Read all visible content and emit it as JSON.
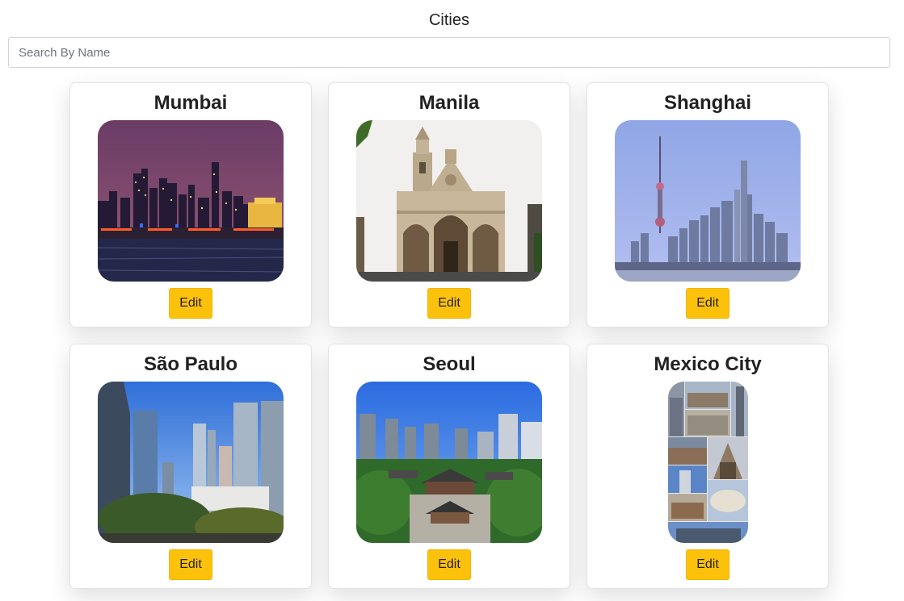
{
  "header": {
    "title": "Cities"
  },
  "search": {
    "placeholder": "Search By Name",
    "value": ""
  },
  "cities": [
    {
      "name": "Mumbai",
      "edit_label": "Edit"
    },
    {
      "name": "Manila",
      "edit_label": "Edit"
    },
    {
      "name": "Shanghai",
      "edit_label": "Edit"
    },
    {
      "name": "São Paulo",
      "edit_label": "Edit"
    },
    {
      "name": "Seoul",
      "edit_label": "Edit"
    },
    {
      "name": "Mexico City",
      "edit_label": "Edit"
    }
  ],
  "colors": {
    "button": "#fcc10b",
    "card_border": "#e3e3e3"
  }
}
